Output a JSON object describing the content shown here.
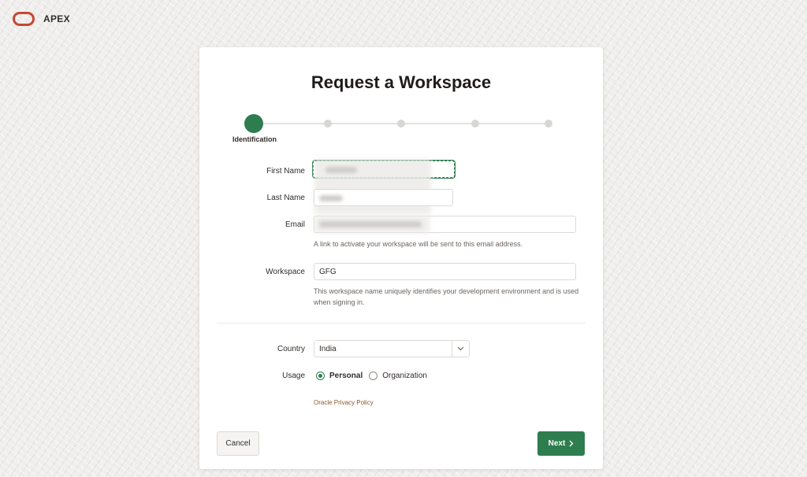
{
  "app": {
    "brand": "APEX",
    "brand_color": "#c74634"
  },
  "page": {
    "title": "Request a Workspace"
  },
  "stepper": {
    "active_label": "Identification",
    "total_steps": 5,
    "active_step": 1,
    "accent_color": "#2e7d4f"
  },
  "form": {
    "first_name": {
      "label": "First Name",
      "value": ""
    },
    "last_name": {
      "label": "Last Name",
      "value": ""
    },
    "email": {
      "label": "Email",
      "value": "",
      "help": "A link to activate your workspace will be sent to this email address."
    },
    "workspace": {
      "label": "Workspace",
      "value": "GFG",
      "help": "This workspace name uniquely identifies your development environment and is used when signing in."
    },
    "country": {
      "label": "Country",
      "selected": "India"
    },
    "usage": {
      "label": "Usage",
      "options": [
        "Personal",
        "Organization"
      ],
      "selected": "Personal"
    },
    "privacy_link": "Oracle Privacy Policy"
  },
  "buttons": {
    "cancel": "Cancel",
    "next": "Next"
  },
  "icons": {
    "brand": "oracle-ring-icon",
    "select": "chevron-down-icon",
    "next": "chevron-right-icon"
  }
}
